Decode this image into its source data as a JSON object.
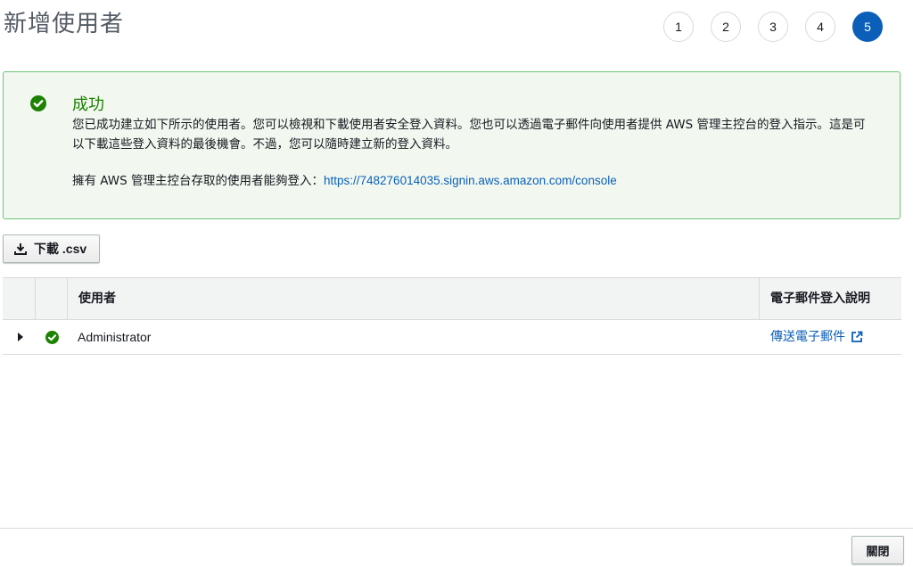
{
  "page": {
    "title": "新增使用者"
  },
  "steps": [
    {
      "label": "1",
      "active": false
    },
    {
      "label": "2",
      "active": false
    },
    {
      "label": "3",
      "active": false
    },
    {
      "label": "4",
      "active": false
    },
    {
      "label": "5",
      "active": true
    }
  ],
  "alert": {
    "title": "成功",
    "message": "您已成功建立如下所示的使用者。您可以檢視和下載使用者安全登入資料。您也可以透過電子郵件向使用者提供 AWS 管理主控台的登入指示。這是可以下載這些登入資料的最後機會。不過，您可以隨時建立新的登入資料。",
    "login_prefix": "擁有 AWS 管理主控台存取的使用者能夠登入：",
    "login_url": "https://748276014035.signin.aws.amazon.com/console",
    "icon": "check-circle-icon",
    "accent_color": "#1d8102"
  },
  "toolbar": {
    "download_label": "下載 .csv",
    "download_icon": "download-icon"
  },
  "table": {
    "headers": {
      "user": "使用者",
      "email": "電子郵件登入說明"
    },
    "rows": [
      {
        "user": "Administrator",
        "email_link": "傳送電子郵件",
        "status_icon": "check-circle-icon",
        "expand_icon": "caret-right-icon",
        "external_icon": "external-link-icon"
      }
    ]
  },
  "footer": {
    "close_label": "關閉"
  },
  "colors": {
    "primary": "#0b5fb8",
    "success": "#1d8102",
    "success_bg": "#f2f8f0",
    "border": "#d5dbdb"
  }
}
